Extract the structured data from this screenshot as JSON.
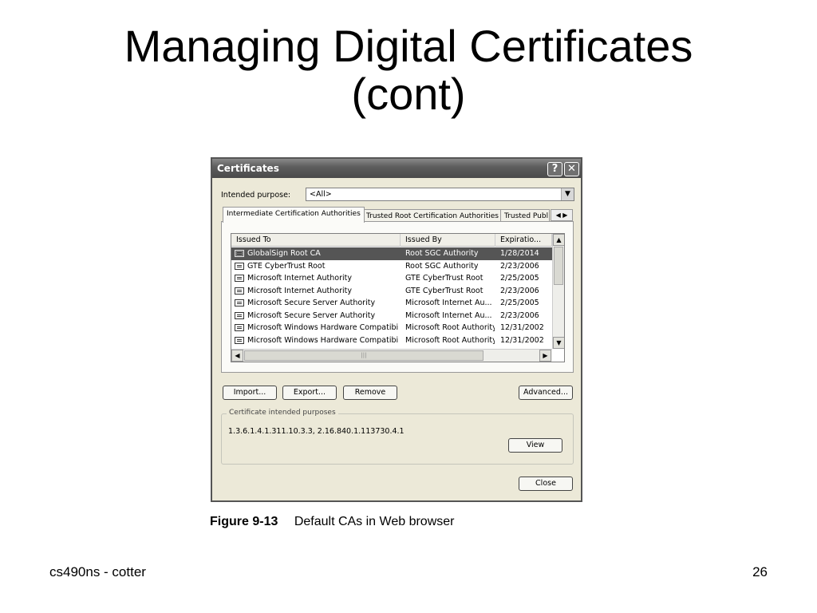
{
  "slide": {
    "title_line1": "Managing Digital Certificates",
    "title_line2": "(cont)",
    "caption_number": "Figure 9-13",
    "caption_text": "Default CAs in Web browser",
    "footer_left": "cs490ns - cotter",
    "footer_right": "26"
  },
  "dialog": {
    "title": "Certificates",
    "help_glyph": "?",
    "close_glyph": "✕",
    "intended_purpose_label": "Intended purpose:",
    "intended_purpose_value": "<All>",
    "tabs": [
      "Intermediate Certification Authorities",
      "Trusted Root Certification Authorities",
      "Trusted Publ"
    ],
    "columns": [
      "Issued To",
      "Issued By",
      "Expiratio..."
    ],
    "rows": [
      {
        "issued_to": "GlobalSign Root CA",
        "issued_by": "Root SGC Authority",
        "expiration": "1/28/2014",
        "selected": true
      },
      {
        "issued_to": "GTE CyberTrust Root",
        "issued_by": "Root SGC Authority",
        "expiration": "2/23/2006",
        "selected": false
      },
      {
        "issued_to": "Microsoft Internet Authority",
        "issued_by": "GTE CyberTrust Root",
        "expiration": "2/25/2005",
        "selected": false
      },
      {
        "issued_to": "Microsoft Internet Authority",
        "issued_by": "GTE CyberTrust Root",
        "expiration": "2/23/2006",
        "selected": false
      },
      {
        "issued_to": "Microsoft Secure Server Authority",
        "issued_by": "Microsoft Internet Au...",
        "expiration": "2/25/2005",
        "selected": false
      },
      {
        "issued_to": "Microsoft Secure Server Authority",
        "issued_by": "Microsoft Internet Au...",
        "expiration": "2/23/2006",
        "selected": false
      },
      {
        "issued_to": "Microsoft Windows Hardware Compatibility",
        "issued_by": "Microsoft Root Authority",
        "expiration": "12/31/2002",
        "selected": false
      },
      {
        "issued_to": "Microsoft Windows Hardware Compatibility",
        "issued_by": "Microsoft Root Authority",
        "expiration": "12/31/2002",
        "selected": false
      }
    ],
    "buttons": {
      "import": "Import...",
      "export": "Export...",
      "remove": "Remove",
      "advanced": "Advanced...",
      "view": "View",
      "close": "Close"
    },
    "purposes_group_title": "Certificate intended purposes",
    "purposes_value": "1.3.6.1.4.1.311.10.3.3, 2.16.840.1.113730.4.1"
  }
}
